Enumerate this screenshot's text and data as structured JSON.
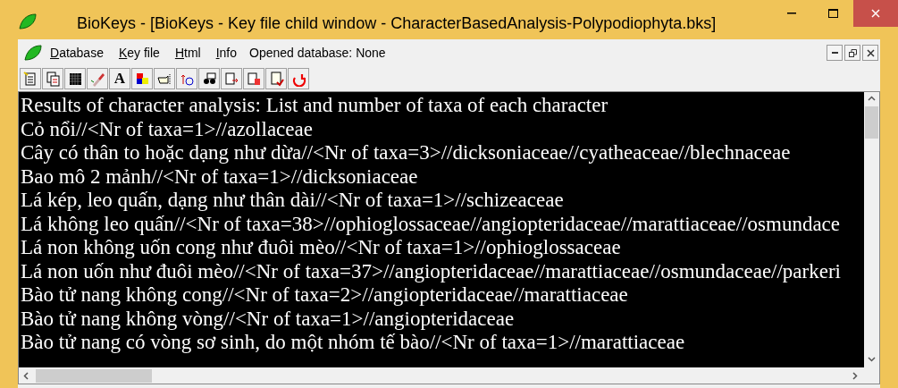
{
  "window": {
    "title": "BioKeys - [BioKeys - Key file child window - CharacterBasedAnalysis-Polypodiophyta.bks]"
  },
  "menu": [
    {
      "label": "Database"
    },
    {
      "label": "Key file"
    },
    {
      "label": "Html"
    },
    {
      "label": "Info"
    }
  ],
  "status": "Opened database: None",
  "toolbar": {
    "font_button": "A"
  },
  "lines": [
    "Results of character analysis: List and number of taxa of each character",
    "Cỏ nổi//<Nr of taxa=1>//azollaceae",
    "Cây có thân to hoặc dạng như dừa//<Nr of taxa=3>//dicksoniaceae//cyatheaceae//blechnaceae",
    "Bao mô 2 mảnh//<Nr of taxa=1>//dicksoniaceae",
    "Lá kép, leo quấn, dạng như thân dài//<Nr of taxa=1>//schizeaceae",
    "Lá không leo quấn//<Nr of taxa=38>//ophioglossaceae//angiopteridaceae//marattiaceae//osmundace",
    "Lá non không uốn cong như đuôi mèo//<Nr of taxa=1>//ophioglossaceae",
    "Lá non uốn như đuôi mèo//<Nr of taxa=37>//angiopteridaceae//marattiaceae//osmundaceae//parkeri",
    "Bào tử nang không cong//<Nr of taxa=2>//angiopteridaceae//marattiaceae",
    "Bào tử nang không vòng//<Nr of taxa=1>//angiopteridaceae",
    "Bào tử nang có vòng sơ sinh, do một nhóm tế bào//<Nr of taxa=1>//marattiaceae"
  ]
}
